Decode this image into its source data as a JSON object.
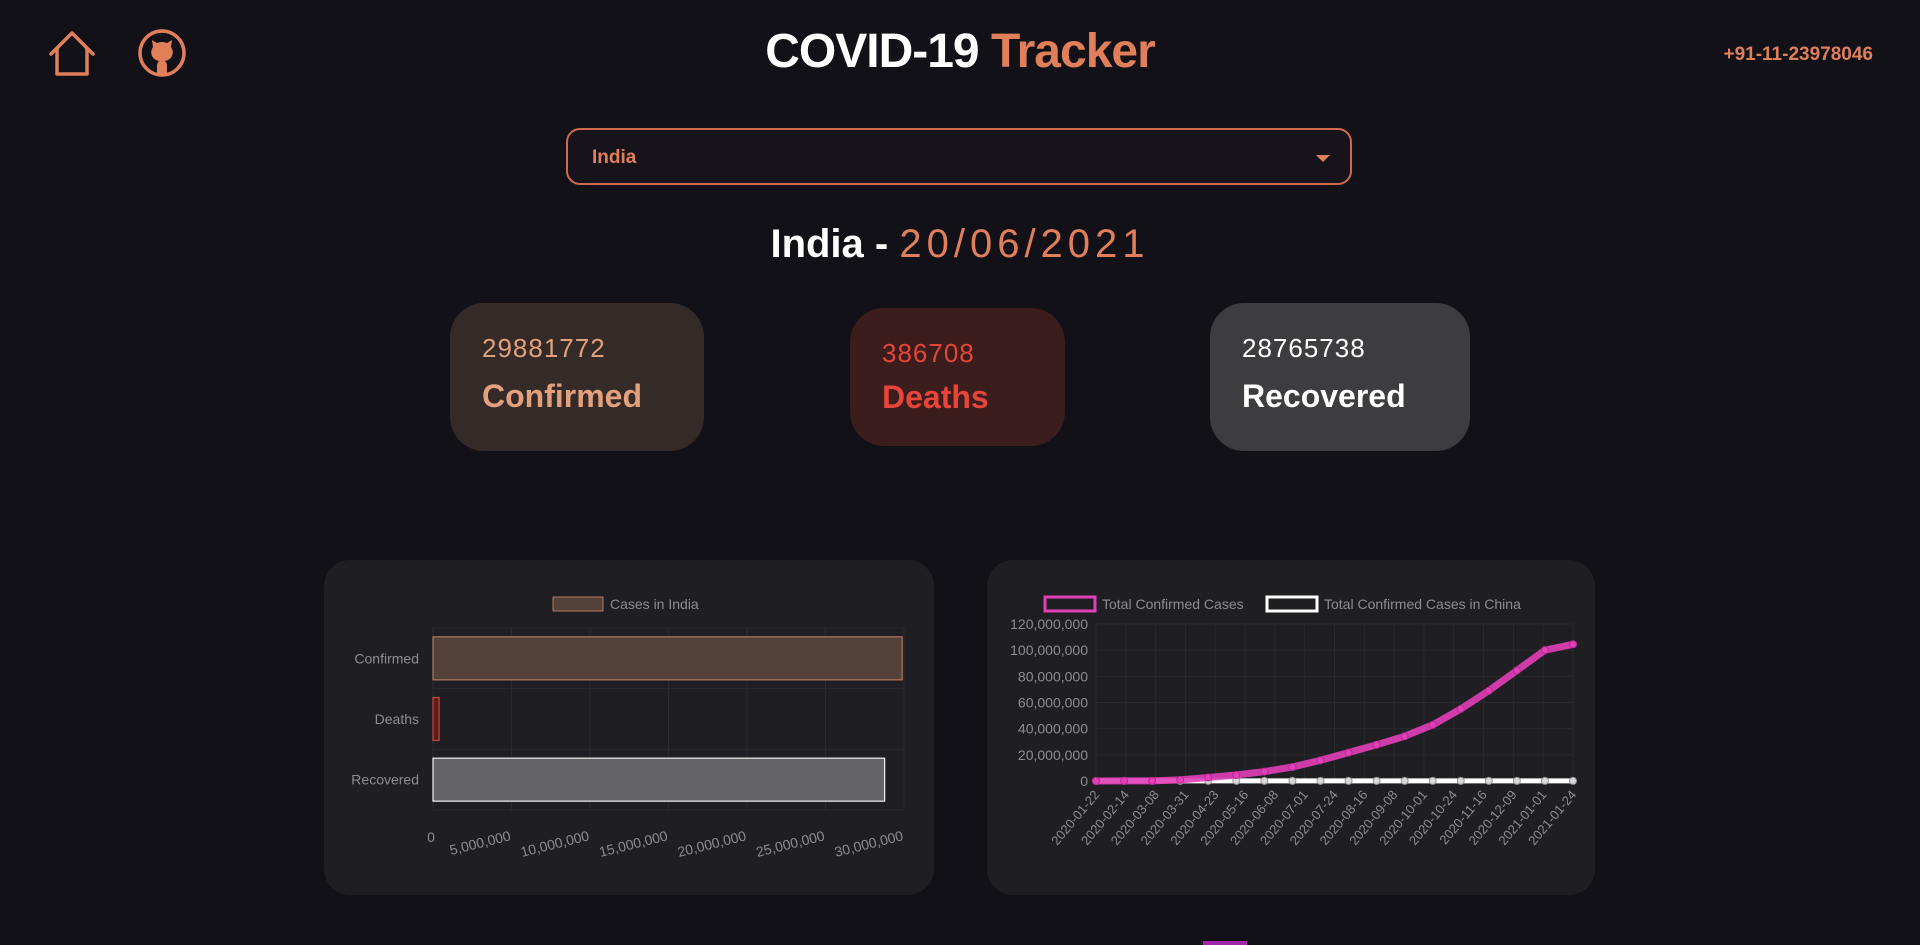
{
  "header": {
    "title_part1": "COVID-19",
    "title_part2": "Tracker",
    "phone": "+91-11-23978046",
    "home_icon": "home-icon",
    "github_icon": "github-icon"
  },
  "country_select": {
    "selected": "India"
  },
  "subheading": {
    "country": "India",
    "separator": " - ",
    "date": "20/06/2021"
  },
  "cards": {
    "confirmed": {
      "value": "29881772",
      "label": "Confirmed"
    },
    "deaths": {
      "value": "386708",
      "label": "Deaths"
    },
    "recovered": {
      "value": "28765738",
      "label": "Recovered"
    }
  },
  "colors": {
    "accent": "#e07f5a",
    "background": "#121118",
    "confirmed": "#e3a07c",
    "deaths": "#e8453a",
    "line_india": "#e23fb8",
    "line_china": "#ffffff"
  },
  "chart_data": [
    {
      "type": "bar",
      "orientation": "horizontal",
      "categories": [
        "Confirmed",
        "Deaths",
        "Recovered"
      ],
      "series": [
        {
          "name": "Cases in India",
          "values": [
            29881772,
            386708,
            28765738
          ]
        }
      ],
      "xlim": [
        0,
        30000000
      ],
      "tick_labels": [
        "0",
        "5,000,000",
        "10,000,000",
        "15,000,000",
        "20,000,000",
        "25,000,000",
        "30,000,000"
      ],
      "legend": "top-center",
      "grid": true
    },
    {
      "type": "line",
      "x": [
        "2020-01-22",
        "2020-02-14",
        "2020-03-08",
        "2020-03-31",
        "2020-04-23",
        "2020-05-16",
        "2020-06-08",
        "2020-07-01",
        "2020-07-24",
        "2020-08-16",
        "2020-09-08",
        "2020-10-01",
        "2020-10-24",
        "2020-11-16",
        "2020-12-09",
        "2021-01-01",
        "2021-01-24"
      ],
      "series": [
        {
          "name": "Total Confirmed Cases",
          "values": [
            557,
            68000,
            110000,
            860000,
            2700000,
            4600000,
            7200000,
            10700000,
            15800000,
            21700000,
            27700000,
            34200000,
            42900000,
            55100000,
            69000000,
            84500000,
            100000000,
            104500000
          ]
        },
        {
          "name": "Total Confirmed Cases in China",
          "values": [
            548,
            66000,
            81000,
            82000,
            83000,
            84000,
            84200,
            85000,
            86000,
            89000,
            90000,
            90500,
            91000,
            92000,
            94000,
            96000,
            98000,
            100000
          ]
        }
      ],
      "ylim": [
        0,
        120000000
      ],
      "y_tick_labels": [
        "0",
        "20,000,000",
        "40,000,000",
        "60,000,000",
        "80,000,000",
        "100,000,000",
        "120,000,000"
      ],
      "legend": "top-center",
      "grid": true
    }
  ]
}
